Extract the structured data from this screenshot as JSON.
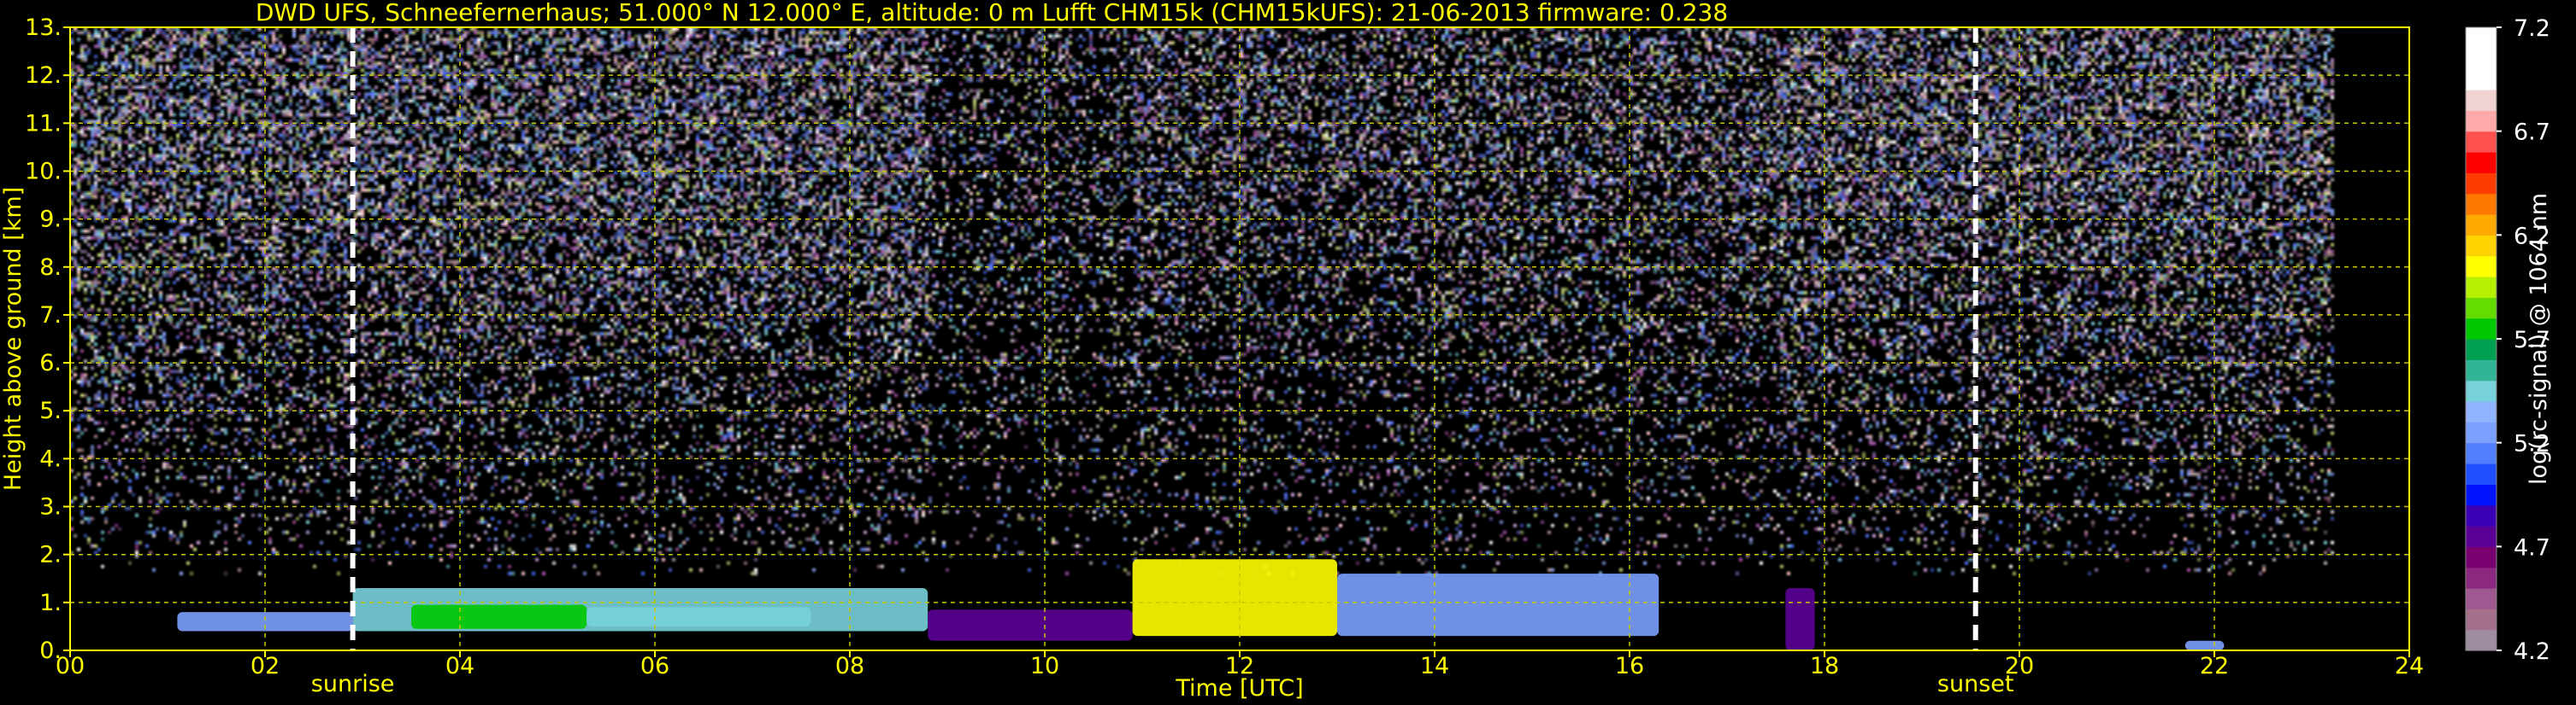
{
  "title": "DWD UFS, Schneefernerhaus; 51.000° N 12.000° E, altitude: 0 m    Lufft CHM15k (CHM15kUFS): 21-06-2013    firmware: 0.238",
  "chart_data": {
    "type": "heatmap",
    "title": "DWD UFS, Schneefernerhaus; 51.000° N 12.000° E, altitude: 0 m    Lufft CHM15k (CHM15kUFS): 21-06-2013    firmware: 0.238",
    "xlabel": "Time [UTC]",
    "ylabel": "Height above ground [km]",
    "xlim": [
      0,
      24
    ],
    "ylim": [
      0,
      13
    ],
    "x_ticks": [
      "00",
      "02",
      "04",
      "06",
      "08",
      "10",
      "12",
      "14",
      "16",
      "18",
      "20",
      "22",
      "24"
    ],
    "y_ticks": [
      "0.",
      "1.",
      "2.",
      "3.",
      "4.",
      "5.",
      "6.",
      "7.",
      "8.",
      "9.",
      "10.",
      "11.",
      "12.",
      "13."
    ],
    "grid": true,
    "data_end_hour": 23.2,
    "events": [
      {
        "label": "sunrise",
        "hour": 2.9
      },
      {
        "label": "sunset",
        "hour": 19.55
      }
    ],
    "layers": [
      {
        "start": 1.1,
        "end": 2.9,
        "base_km": 0.4,
        "top_km": 0.8,
        "level": 5.2
      },
      {
        "start": 2.9,
        "end": 8.8,
        "base_km": 0.4,
        "top_km": 1.3,
        "level": 5.4
      },
      {
        "start": 3.5,
        "end": 5.3,
        "base_km": 0.45,
        "top_km": 0.95,
        "level": 5.8
      },
      {
        "start": 5.3,
        "end": 7.6,
        "base_km": 0.5,
        "top_km": 0.9,
        "level": 5.5
      },
      {
        "start": 8.8,
        "end": 10.9,
        "base_km": 0.2,
        "top_km": 0.85,
        "level": 4.8
      },
      {
        "start": 10.9,
        "end": 13.0,
        "base_km": 0.3,
        "top_km": 1.9,
        "level": 6.1
      },
      {
        "start": 13.0,
        "end": 16.3,
        "base_km": 0.3,
        "top_km": 1.6,
        "level": 5.3
      },
      {
        "start": 17.6,
        "end": 17.9,
        "base_km": 0.0,
        "top_km": 1.3,
        "level": 4.7
      },
      {
        "start": 21.7,
        "end": 22.1,
        "base_km": 0.0,
        "top_km": 0.2,
        "level": 5.3
      }
    ],
    "colorbar": {
      "label": "log(rc-signal) @ 1064 nm",
      "ticks": [
        "4.2",
        "4.7",
        "5.2",
        "5.7",
        "6.2",
        "6.7",
        "7.2"
      ],
      "min": 4.2,
      "max": 7.2,
      "colors": [
        "#a08ca0",
        "#a4708c",
        "#a05890",
        "#8c2880",
        "#780070",
        "#5a0096",
        "#3c00b4",
        "#0014ff",
        "#1e50ff",
        "#5080ff",
        "#7ca0ff",
        "#90b4ff",
        "#78d2dc",
        "#32b496",
        "#00a050",
        "#00c800",
        "#64dc00",
        "#b4f000",
        "#ffff00",
        "#ffd200",
        "#ffaa00",
        "#ff7800",
        "#ff3c00",
        "#ff0000",
        "#ff5050",
        "#ffaaaa",
        "#f0d2d2",
        "#ffffff",
        "#ffffff",
        "#ffffff"
      ]
    }
  }
}
